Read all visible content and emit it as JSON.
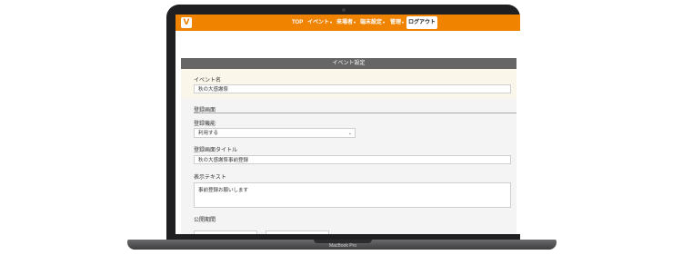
{
  "device": {
    "brand_label": "MacBook Pro"
  },
  "nav": {
    "logo": "V",
    "items": [
      {
        "label": "TOP",
        "dropdown": false
      },
      {
        "label": "イベント",
        "dropdown": true
      },
      {
        "label": "来場者",
        "dropdown": true
      },
      {
        "label": "端末設定",
        "dropdown": true
      },
      {
        "label": "管理",
        "dropdown": true
      }
    ],
    "logout_label": "ログアウト",
    "accent_color": "#f08300"
  },
  "panel": {
    "title": "イベント設定",
    "event_name_label": "イベント名",
    "event_name_value": "秋の大感謝祭",
    "section_title": "登録画面",
    "reg_feature_label": "登録機能",
    "reg_feature_value": "利用する",
    "reg_screen_title_label": "登録画面タイトル",
    "reg_screen_title_value": "秋の大感謝祭事前登録",
    "display_text_label": "表示テキスト",
    "display_text_value": "事前登録お願いします",
    "publish_period_label": "公開期間"
  }
}
